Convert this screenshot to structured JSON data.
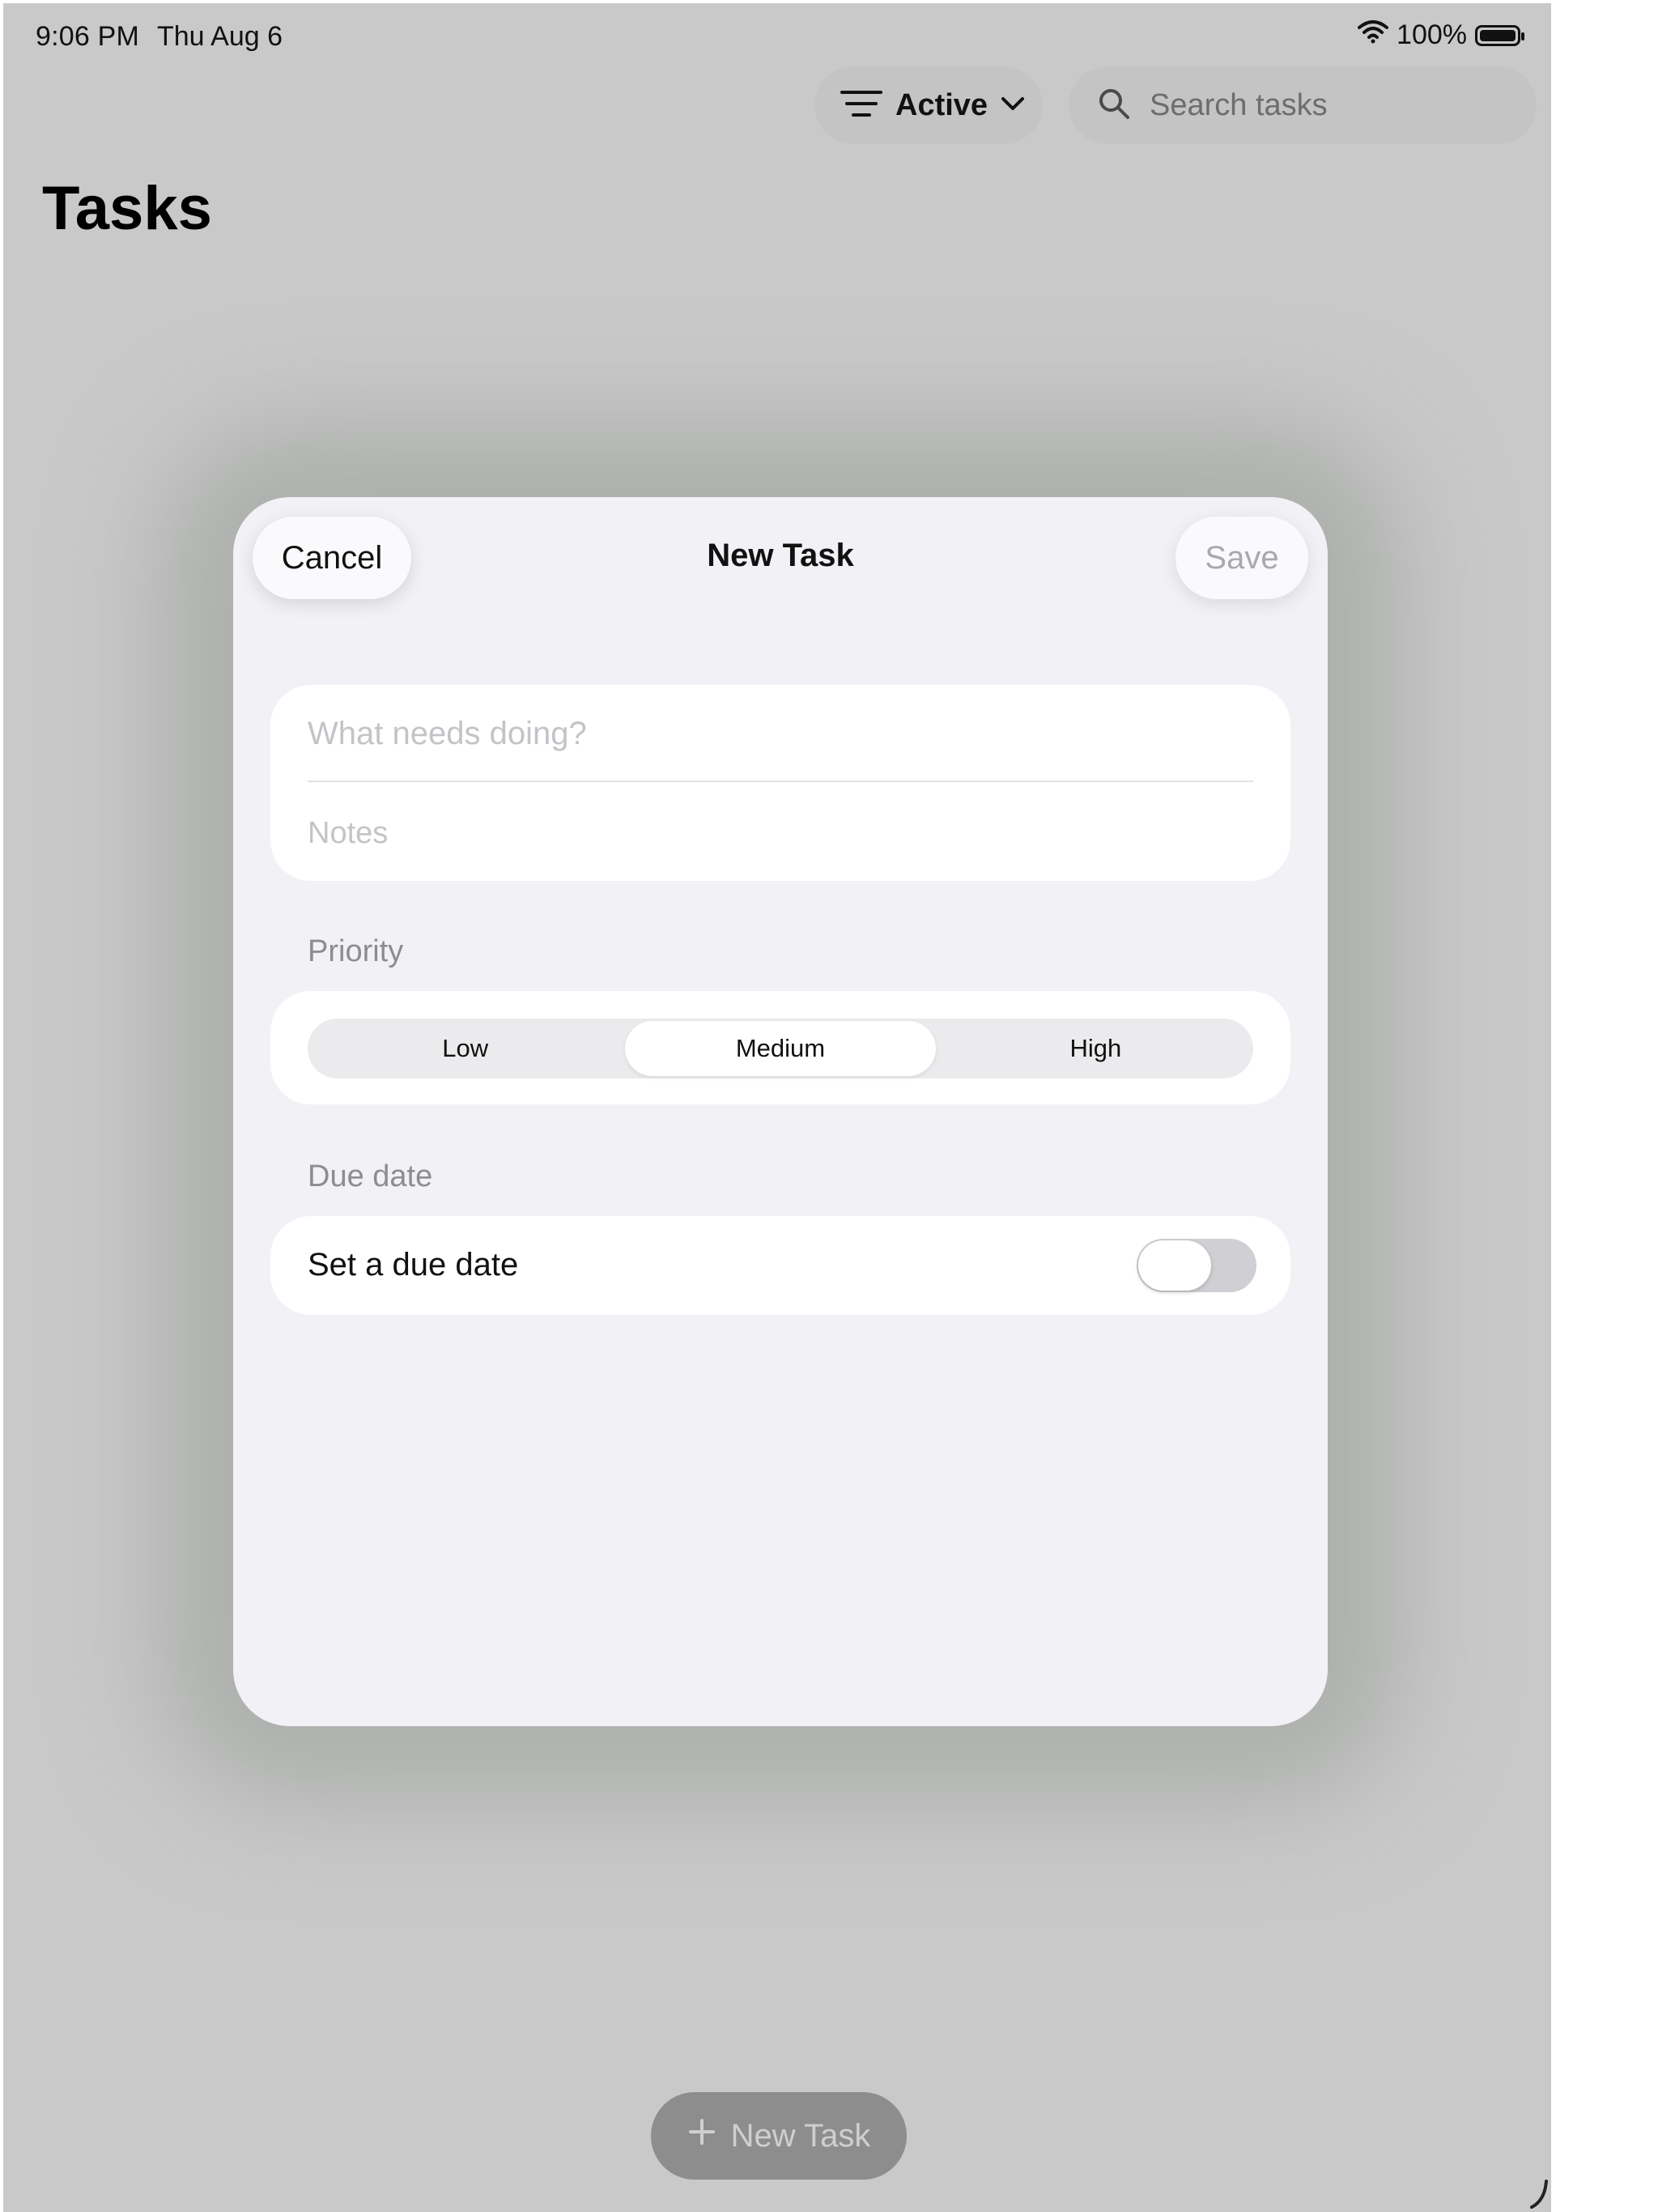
{
  "status_bar": {
    "time": "9:06 PM",
    "date": "Thu Aug 6",
    "battery": "100%"
  },
  "toolbar": {
    "filter_label": "Active",
    "search_placeholder": "Search tasks"
  },
  "page": {
    "title": "Tasks"
  },
  "modal": {
    "title": "New Task",
    "cancel_label": "Cancel",
    "save_label": "Save",
    "title_placeholder": "What needs doing?",
    "notes_placeholder": "Notes",
    "priority_label": "Priority",
    "priority_options": [
      "Low",
      "Medium",
      "High"
    ],
    "priority_selected": "Medium",
    "due_section_label": "Due date",
    "due_toggle_label": "Set a due date",
    "due_toggle_on": false
  },
  "fab": {
    "label": "New Task"
  },
  "colors": {
    "background_dim": "#c9c9c9",
    "modal_background": "#f2f2f6",
    "card_background": "#ffffff",
    "placeholder_text": "#c4c4c8",
    "disabled_text": "#a9a9ad"
  }
}
